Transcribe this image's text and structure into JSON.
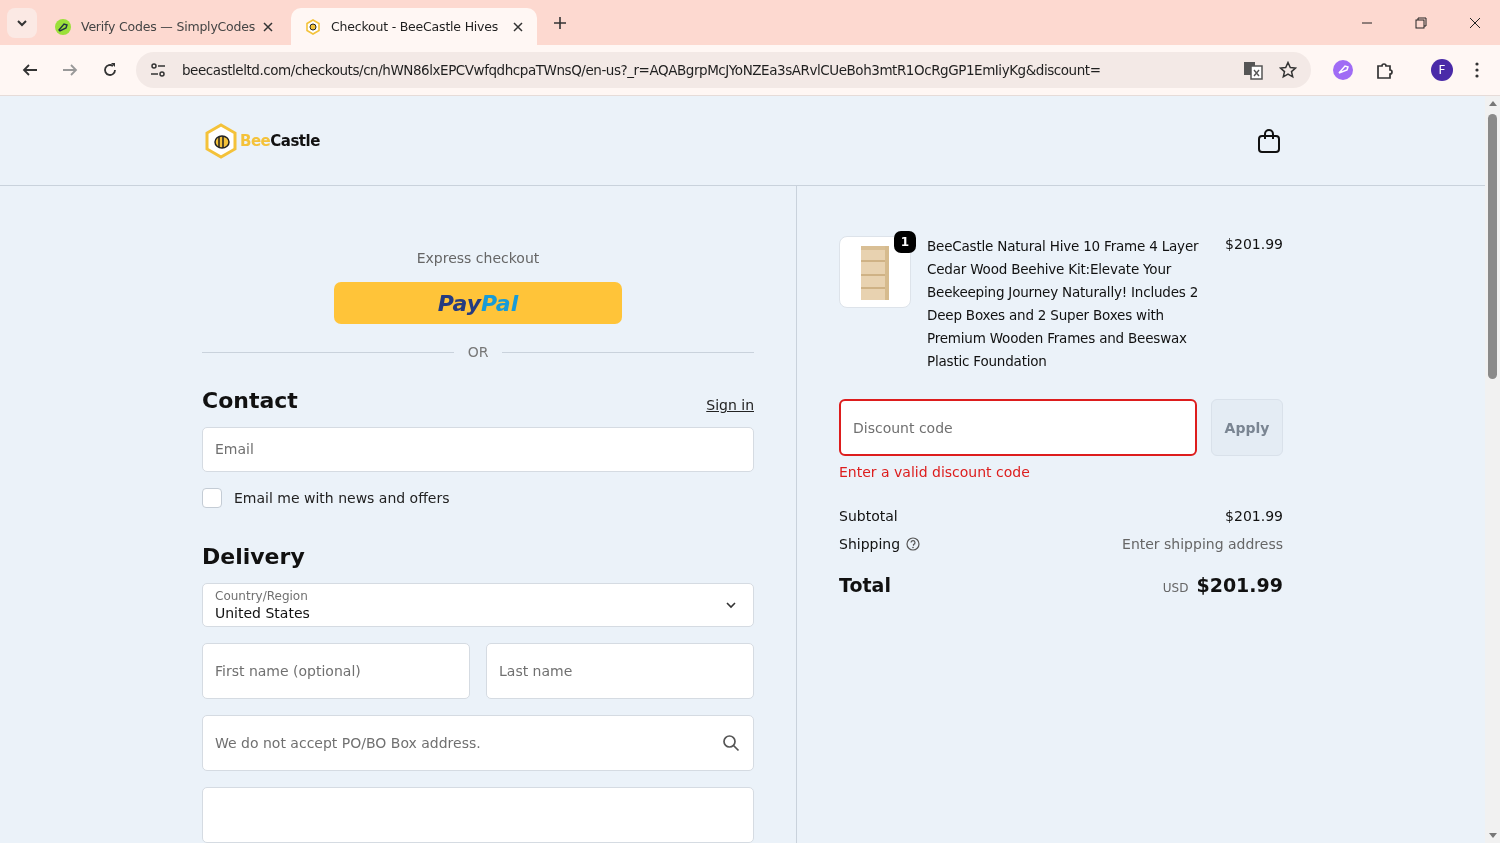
{
  "browser": {
    "tabs": [
      {
        "title": "Verify Codes — SimplyCodes",
        "selected": false
      },
      {
        "title": "Checkout - BeeCastle Hives",
        "selected": true
      }
    ],
    "url": "beecastleltd.com/checkouts/cn/hWN86lxEPCVwfqdhcpaTWnsQ/en-us?_r=AQABgrpMcJYoNZEa3sARvlCUeBoh3mtR1OcRgGP1EmIiyKg&discount=",
    "profile": "F"
  },
  "header": {
    "logo": [
      {
        "text": "Bee",
        "kind": "accent"
      },
      {
        "text": "Castle",
        "kind": "plain"
      }
    ]
  },
  "checkout": {
    "express_label": "Express checkout",
    "paypal": [
      {
        "text": "Pay",
        "kind": "dark"
      },
      {
        "text": "Pal",
        "kind": "light"
      }
    ],
    "or": "OR",
    "contact": {
      "heading": "Contact",
      "sign_in": "Sign in",
      "email_placeholder": "Email",
      "newsletter": {
        "label": "Email me with news and offers",
        "checked": false
      }
    },
    "delivery": {
      "heading": "Delivery",
      "country_label": "Country/Region",
      "country": "United States",
      "first_name_placeholder": "First name (optional)",
      "last_name_placeholder": "Last name",
      "address_placeholder": "We do not accept PO/BO Box address."
    }
  },
  "summary": {
    "item": {
      "quantity": "1",
      "name": "BeeCastle Natural Hive 10 Frame 4 Layer Cedar Wood Beehive Kit:Elevate Your Beekeeping Journey Naturally! Includes 2 Deep Boxes and 2 Super Boxes with Premium Wooden Frames and Beeswax Plastic Foundation",
      "price": "$201.99"
    },
    "discount": {
      "placeholder": "Discount code",
      "error": "Enter a valid discount code",
      "apply": "Apply",
      "invalid": true
    },
    "subtotal": {
      "label": "Subtotal",
      "value": "$201.99"
    },
    "shipping": {
      "label": "Shipping",
      "value": "Enter shipping address"
    },
    "total": {
      "label": "Total",
      "currency": "USD",
      "value": "$201.99"
    }
  }
}
